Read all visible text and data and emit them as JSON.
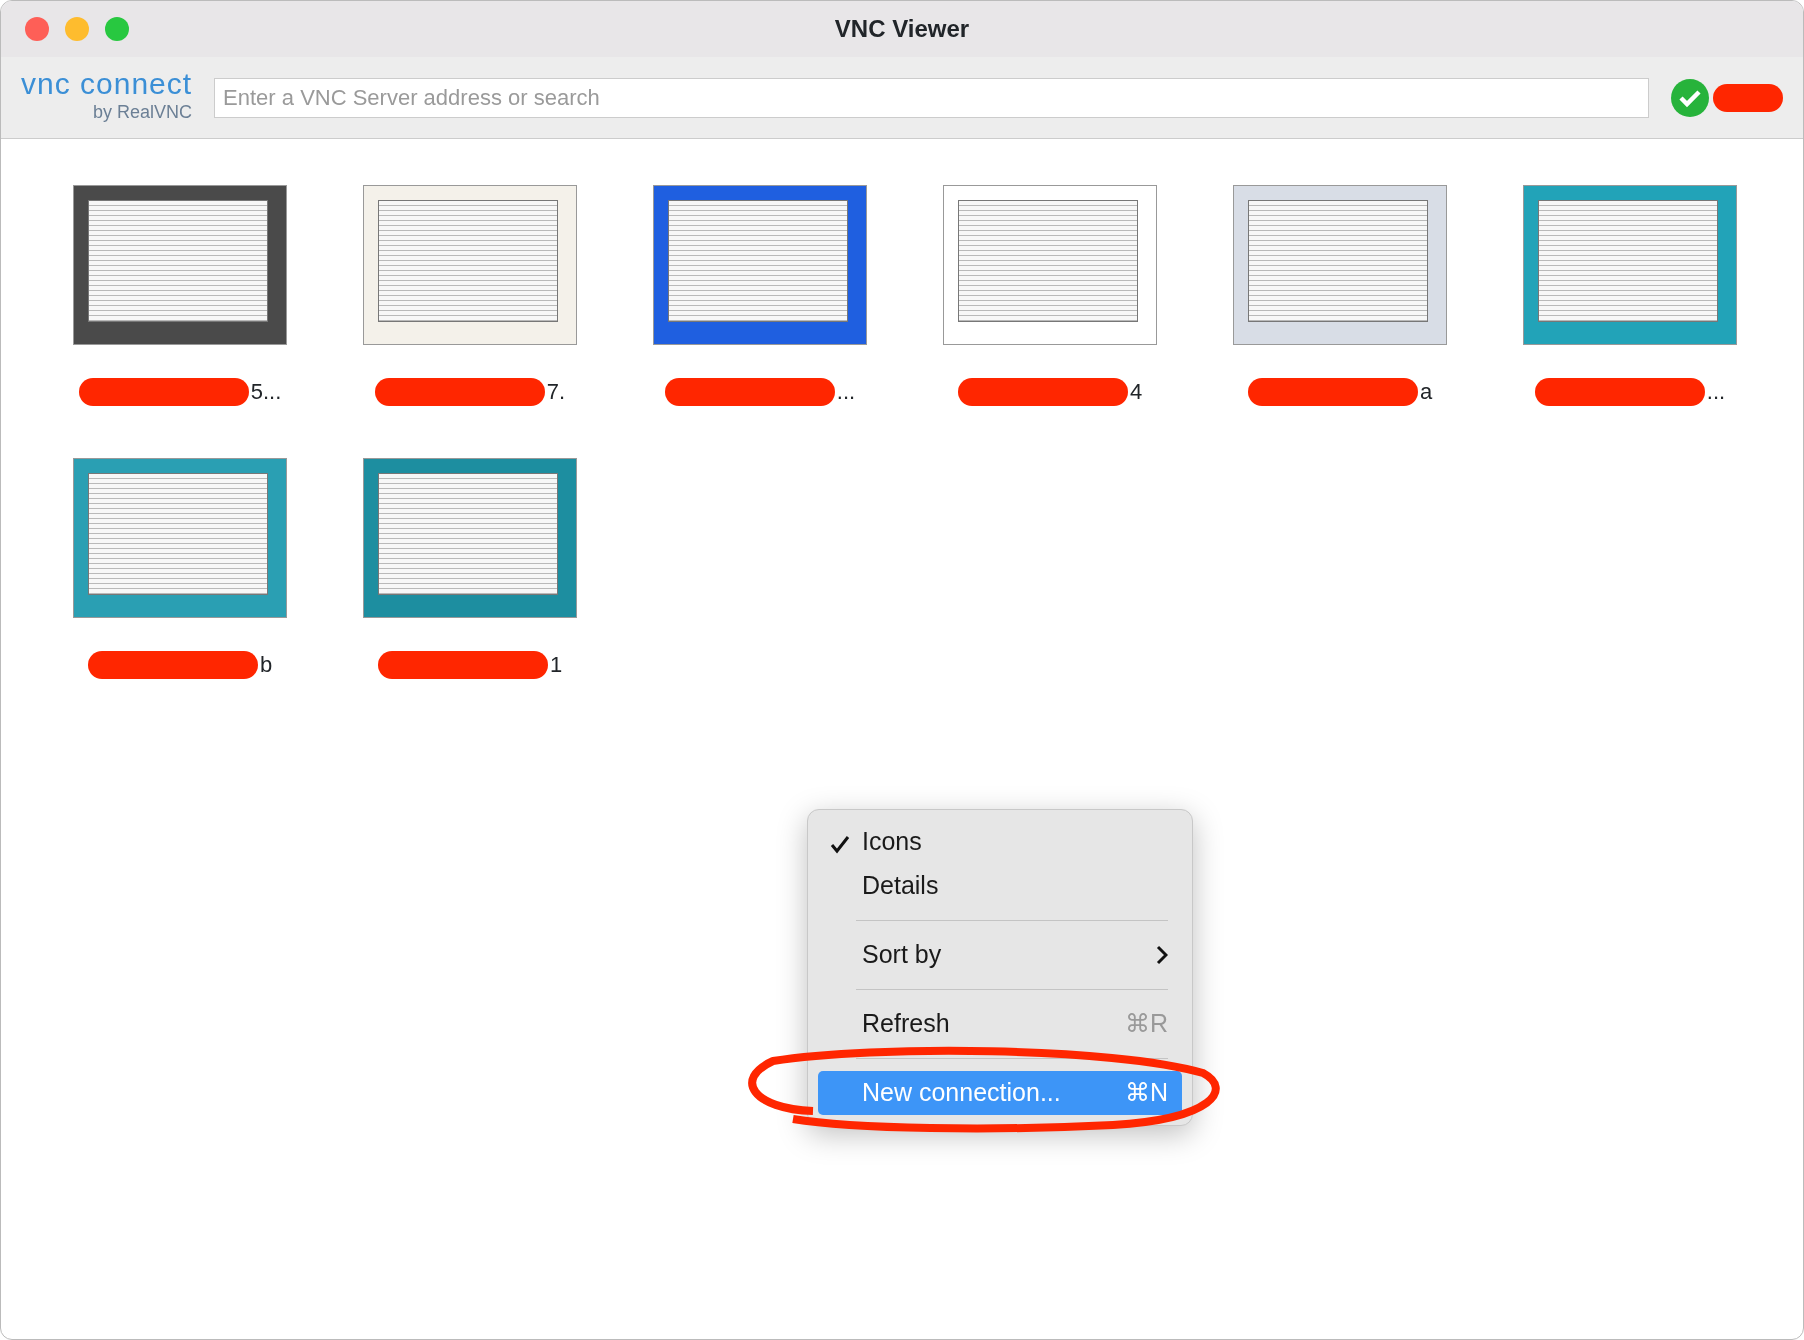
{
  "window": {
    "title": "VNC Viewer"
  },
  "toolbar": {
    "logo_main": "vnc connect",
    "logo_sub": "by RealVNC",
    "search": {
      "placeholder": "Enter a VNC Server address or search"
    },
    "signed_in": true,
    "account_redacted": true
  },
  "hosts": [
    {
      "label": "5...",
      "redacted": true,
      "color": "#4a4a4a"
    },
    {
      "label": "7.",
      "redacted": true,
      "color": "#f4f1ea"
    },
    {
      "label": "...",
      "redacted": true,
      "color": "#1f5fe0"
    },
    {
      "label": "4",
      "redacted": true,
      "color": "#ffffff"
    },
    {
      "label": "a",
      "redacted": true,
      "color": "#d8dde6"
    },
    {
      "label": "...",
      "redacted": true,
      "color": "#22a3b8"
    },
    {
      "label": "b",
      "redacted": true,
      "color": "#2a9fb3"
    },
    {
      "label": "1",
      "redacted": true,
      "color": "#1d8ea0"
    }
  ],
  "context_menu": {
    "items": [
      {
        "kind": "item",
        "label": "Icons",
        "checked": true,
        "selected": false
      },
      {
        "kind": "item",
        "label": "Details",
        "checked": false,
        "selected": false
      },
      {
        "kind": "separator"
      },
      {
        "kind": "submenu",
        "label": "Sort by",
        "selected": false
      },
      {
        "kind": "separator"
      },
      {
        "kind": "item",
        "label": "Refresh",
        "shortcut": "⌘R",
        "checked": false,
        "selected": false
      },
      {
        "kind": "separator"
      },
      {
        "kind": "item",
        "label": "New connection...",
        "shortcut": "⌘N",
        "checked": false,
        "selected": true
      }
    ],
    "annotated": true
  }
}
